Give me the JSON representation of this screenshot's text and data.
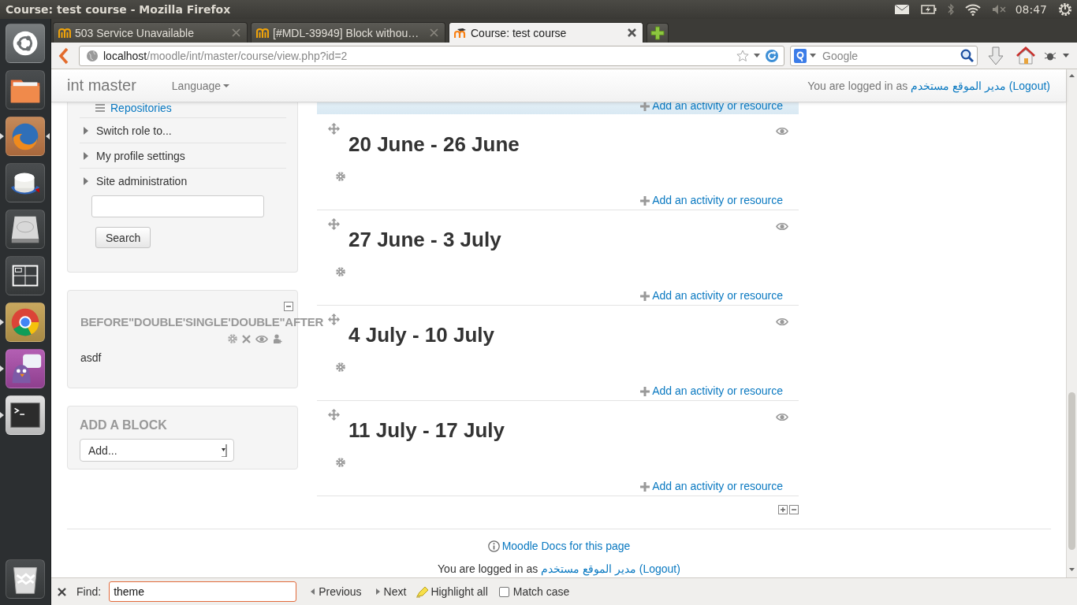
{
  "top_panel": {
    "title": "Course: test course - Mozilla Firefox",
    "clock": "08:47"
  },
  "launcher": [
    {
      "kind": "dash",
      "running": false,
      "focused": false
    },
    {
      "kind": "files",
      "running": false,
      "focused": false
    },
    {
      "kind": "firefox",
      "running": true,
      "focused": true
    },
    {
      "kind": "dial",
      "running": false,
      "focused": false
    },
    {
      "kind": "disk",
      "running": false,
      "focused": false
    },
    {
      "kind": "workspaces",
      "running": false,
      "focused": false
    },
    {
      "kind": "chrome",
      "running": true,
      "focused": false
    },
    {
      "kind": "pidgin",
      "running": true,
      "focused": false
    },
    {
      "kind": "terminal",
      "running": true,
      "focused": false
    },
    {
      "kind": "trash",
      "running": false,
      "focused": false
    }
  ],
  "tabs": [
    {
      "label": "503 Service Unavailable",
      "kind": "old",
      "selected": false
    },
    {
      "label": "[#MDL-39949] Block withou…",
      "kind": "old",
      "selected": false
    },
    {
      "label": "Course: test course",
      "kind": "new",
      "selected": true
    }
  ],
  "address_bar": {
    "host": "localhost",
    "path": "/moodle/int/master/course/view.php?id=2"
  },
  "search_box": {
    "placeholder": "Google"
  },
  "moodle": {
    "site_name": "int master",
    "language_menu": "Language",
    "login_info": {
      "prefix": "You are logged in as",
      "user": "مدير الموقع مستخدم",
      "logout": "(Logout)"
    },
    "navigation": {
      "items": [
        {
          "label": "Repositories",
          "kind": "link"
        },
        {
          "label": "Switch role to...",
          "kind": "branch",
          "expanded": false
        },
        {
          "label": "My profile settings",
          "kind": "branch",
          "expanded": false
        },
        {
          "label": "Site administration",
          "kind": "branch",
          "expanded": false
        }
      ],
      "search_button": "Search"
    },
    "blocks": [
      {
        "title": "BEFORE\"DOUBLE'SINGLE'DOUBLE\"AFTER",
        "content": "asdf"
      }
    ],
    "add_block": {
      "title": "ADD A BLOCK",
      "select": "Add..."
    },
    "sections": [
      {
        "highlighted": true,
        "add_link": "Add an activity or resource"
      },
      {
        "title": "20 June - 26 June",
        "highlighted": false,
        "add_link": "Add an activity or resource"
      },
      {
        "title": "27 June - 3 July",
        "highlighted": false,
        "add_link": "Add an activity or resource"
      },
      {
        "title": "4 July - 10 July",
        "highlighted": false,
        "add_link": "Add an activity or resource"
      },
      {
        "title": "11 July - 17 July",
        "highlighted": false,
        "add_link": "Add an activity or resource"
      }
    ],
    "footer": {
      "docs_link": "Moodle Docs for this page",
      "login_info": {
        "prefix": "You are logged in as",
        "user": "مدير الموقع مستخدم",
        "logout": "(Logout)"
      }
    }
  },
  "find_bar": {
    "label": "Find:",
    "value": "theme",
    "previous": "Previous",
    "next": "Next",
    "highlight_all": "Highlight all",
    "match_case": "Match case",
    "match_case_checked": false
  }
}
